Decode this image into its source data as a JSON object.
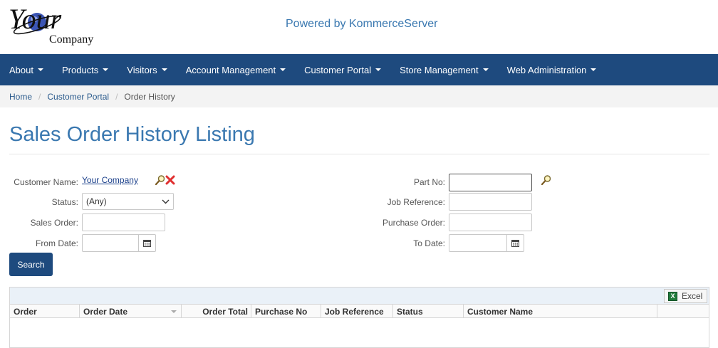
{
  "logo": {
    "line1": "Your",
    "line2": "Company"
  },
  "header": {
    "powered_by": "Powered by KommerceServer"
  },
  "nav": {
    "items": [
      {
        "label": "About"
      },
      {
        "label": "Products"
      },
      {
        "label": "Visitors"
      },
      {
        "label": "Account Management"
      },
      {
        "label": "Customer Portal"
      },
      {
        "label": "Store Management"
      },
      {
        "label": "Web Administration"
      }
    ]
  },
  "breadcrumb": {
    "home": "Home",
    "section": "Customer Portal",
    "current": "Order History"
  },
  "page": {
    "title": "Sales Order History Listing"
  },
  "form": {
    "customer_name_label": "Customer Name:",
    "customer_name_value": "Your Company",
    "status_label": "Status:",
    "status_value": "(Any)",
    "sales_order_label": "Sales Order:",
    "from_date_label": "From Date:",
    "part_no_label": "Part No:",
    "job_reference_label": "Job Reference:",
    "purchase_order_label": "Purchase Order:",
    "to_date_label": "To Date:",
    "search_label": "Search"
  },
  "grid": {
    "excel_label": "Excel",
    "columns": [
      "Order",
      "Order Date",
      "Order Total",
      "Purchase No",
      "Job Reference",
      "Status",
      "Customer Name"
    ]
  },
  "colors": {
    "nav_bg": "#1e4a7e",
    "title": "#3a78b0",
    "link": "#1a3f8a"
  }
}
